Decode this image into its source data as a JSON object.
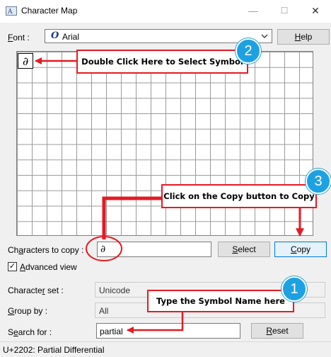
{
  "window": {
    "title": "Character Map",
    "minimize_symbol": "—",
    "maximize_symbol": "☐",
    "close_symbol": "✕"
  },
  "font_row": {
    "label_key": "F",
    "label_rest": "ont :",
    "font_glyph": "O",
    "font_value": "Arial",
    "help_key": "H",
    "help_rest": "elp"
  },
  "grid": {
    "first_char": "∂"
  },
  "copy_row": {
    "label_prefix": "Ch",
    "label_key": "a",
    "label_rest": "racters to copy :",
    "value": "∂",
    "select_key": "S",
    "select_rest": "elect",
    "copy_key": "C",
    "copy_rest": "opy"
  },
  "advanced": {
    "label_key": "A",
    "label_rest": "dvanced view",
    "checked": true,
    "check_glyph": "✓"
  },
  "charset": {
    "label_prefix": "Characte",
    "label_key": "r",
    "label_rest": " set :",
    "value": "Unicode"
  },
  "groupby": {
    "label_key": "G",
    "label_rest": "roup by :",
    "value": "All"
  },
  "search": {
    "label_prefix": "S",
    "label_key": "e",
    "label_rest": "arch for :",
    "value": "partial",
    "reset_key": "R",
    "reset_rest": "eset"
  },
  "status": {
    "text": "U+2202: Partial Differential"
  },
  "annotations": {
    "callout1": {
      "text": "Type the Symbol Name here",
      "badge": "1"
    },
    "callout2": {
      "text": "Double Click Here to Select Symbol",
      "badge": "2"
    },
    "callout3": {
      "text": "Click on the Copy button to Copy",
      "badge": "3"
    },
    "accent_red": "#e31b23",
    "badge_blue": "#1da1e2"
  }
}
